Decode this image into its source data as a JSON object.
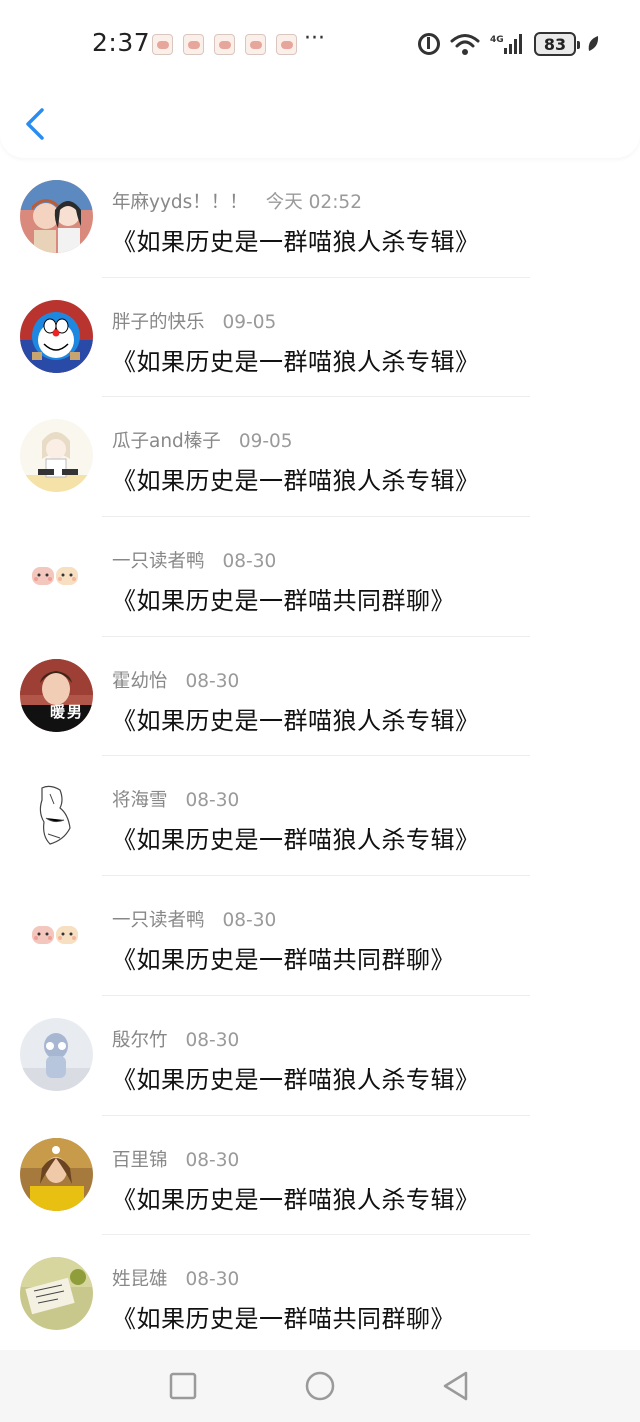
{
  "status_bar": {
    "time": "2:37",
    "more": "···",
    "battery": "83"
  },
  "messages": [
    {
      "name": "年麻yyds！！！",
      "date": "今天 02:52",
      "title": "《如果历史是一群喵狼人杀专辑》",
      "avatar": "couple-anime-avatar"
    },
    {
      "name": "胖子的快乐",
      "date": "09-05",
      "title": "《如果历史是一群喵狼人杀专辑》",
      "avatar": "doraemon-avatar"
    },
    {
      "name": "瓜子and榛子",
      "date": "09-05",
      "title": "《如果历史是一群喵狼人杀专辑》",
      "avatar": "anime-girl-avatar"
    },
    {
      "name": "一只读者鸭",
      "date": "08-30",
      "title": "《如果历史是一群喵共同群聊》",
      "avatar": "bread-cats-avatar"
    },
    {
      "name": "霍幼怡",
      "date": "08-30",
      "title": "《如果历史是一群喵狼人杀专辑》",
      "avatar": "boy-photo-avatar",
      "avatar_text": "暖男"
    },
    {
      "name": "将海雪",
      "date": "08-30",
      "title": "《如果历史是一群喵狼人杀专辑》",
      "avatar": "sketch-avatar"
    },
    {
      "name": "一只读者鸭",
      "date": "08-30",
      "title": "《如果历史是一群喵共同群聊》",
      "avatar": "bread-cats-avatar"
    },
    {
      "name": "殷尔竹",
      "date": "08-30",
      "title": "《如果历史是一群喵狼人杀专辑》",
      "avatar": "toy-figure-avatar"
    },
    {
      "name": "百里锦",
      "date": "08-30",
      "title": "《如果历史是一群喵狼人杀专辑》",
      "avatar": "girl-photo-avatar"
    },
    {
      "name": "姓昆雄",
      "date": "08-30",
      "title": "《如果历史是一群喵共同群聊》",
      "avatar": "note-photo-avatar"
    }
  ],
  "colors": {
    "accent": "#2a8cf0",
    "name_text": "#888888",
    "title_text": "#111111",
    "divider": "#eeeeee",
    "navbar_bg": "#f6f6f6"
  }
}
